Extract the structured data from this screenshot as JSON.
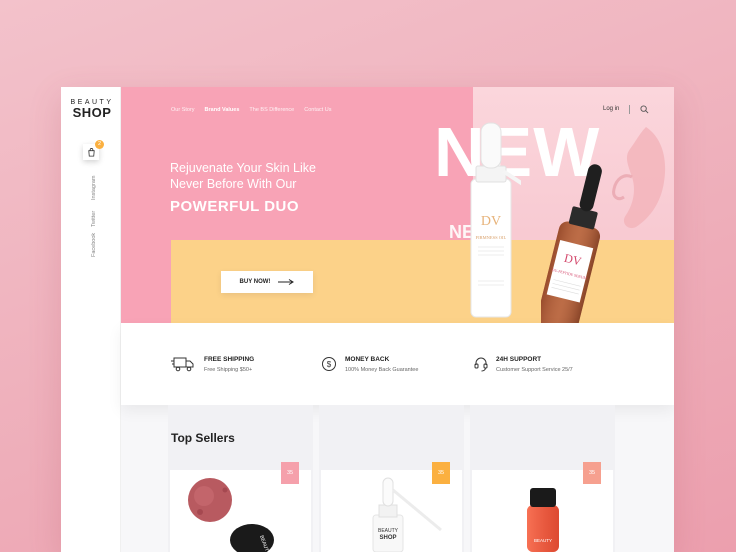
{
  "brand": {
    "top": "BEAUTY",
    "bottom": "SHOP"
  },
  "cart": {
    "count": "2"
  },
  "social": [
    "Instagram",
    "Twitter",
    "Facebook"
  ],
  "nav": [
    {
      "label": "Our Story",
      "active": false
    },
    {
      "label": "Brand Values",
      "active": true
    },
    {
      "label": "The BS Difference",
      "active": false
    },
    {
      "label": "Contact Us",
      "active": false
    }
  ],
  "header": {
    "login": "Log in"
  },
  "hero": {
    "headline": "Rejuvenate Your Skin Like Never Before With Our",
    "highlight": "POWERFUL DUO",
    "big_word": "NEW",
    "small_word": "NEW",
    "cta": "BUY NOW!"
  },
  "products_hero": [
    {
      "logo": "DV",
      "name": "FIRMNESS OIL"
    },
    {
      "logo": "DV",
      "name": "DU-PEPTIDE SERUM"
    }
  ],
  "features": [
    {
      "icon": "truck-icon",
      "title": "FREE SHIPPING",
      "subtitle": "Free Shipping $50+"
    },
    {
      "icon": "dollar-coin-icon",
      "title": "MONEY BACK",
      "subtitle": "100% Money Back Guarantee"
    },
    {
      "icon": "headset-icon",
      "title": "24H SUPPORT",
      "subtitle": "Customer Support Service 25/7"
    }
  ],
  "top_sellers": {
    "title": "Top Sellers",
    "tags": [
      "35",
      "35",
      "35"
    ]
  },
  "colors": {
    "pink": "#f8a3b6",
    "yellow": "#fcd289",
    "tag_pink": "#f5a0ab",
    "tag_yellow": "#fbb040",
    "tag_salmon": "#f6a08f"
  }
}
